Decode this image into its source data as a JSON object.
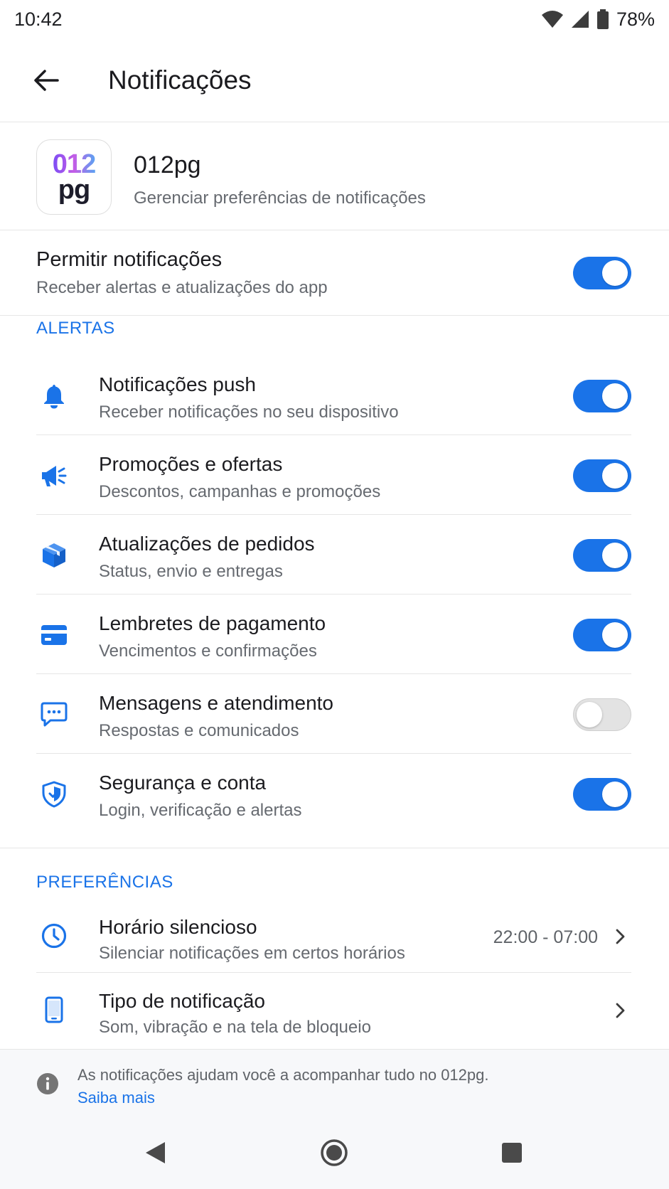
{
  "status_bar": {
    "time": "10:42",
    "battery": "78%"
  },
  "app_bar": {
    "title": "Notificações"
  },
  "app_header": {
    "logo_top": "012",
    "logo_bottom": "pg",
    "name": "012pg",
    "description": "Gerenciar preferências de notificações"
  },
  "master": {
    "title": "Permitir notificações",
    "subtitle": "Receber alertas e atualizações do app",
    "enabled": true
  },
  "alerts": {
    "section_label": "ALERTAS",
    "items": [
      {
        "icon": "bell-icon",
        "title": "Notificações push",
        "subtitle": "Receber notificações no seu dispositivo",
        "enabled": true
      },
      {
        "icon": "megaphone-icon",
        "title": "Promoções e ofertas",
        "subtitle": "Descontos, campanhas e promoções",
        "enabled": true
      },
      {
        "icon": "package-icon",
        "title": "Atualizações de pedidos",
        "subtitle": "Status, envio e entregas",
        "enabled": true
      },
      {
        "icon": "credit-card-icon",
        "title": "Lembretes de pagamento",
        "subtitle": "Vencimentos e confirmações",
        "enabled": true
      },
      {
        "icon": "chat-icon",
        "title": "Mensagens e atendimento",
        "subtitle": "Respostas e comunicados",
        "enabled": false
      },
      {
        "icon": "shield-icon",
        "title": "Segurança e conta",
        "subtitle": "Login, verificação e alertas",
        "enabled": true
      }
    ]
  },
  "preferences": {
    "section_label": "PREFERÊNCIAS",
    "items": [
      {
        "icon": "clock-icon",
        "title": "Horário silencioso",
        "subtitle": "Silenciar notificações em certos horários",
        "value": "22:00 - 07:00"
      },
      {
        "icon": "phone-icon",
        "title": "Tipo de notificação",
        "subtitle": "Som, vibração e na tela de bloqueio",
        "value": ""
      }
    ]
  },
  "footer": {
    "info_text": "As notificações ajudam você a acompanhar tudo no 012pg.",
    "link_text": "Saiba mais"
  },
  "colors": {
    "accent": "#1a73e8",
    "toggle_off": "#e3e3e3",
    "text_primary": "#1b1b1f",
    "text_secondary": "#666a70"
  }
}
